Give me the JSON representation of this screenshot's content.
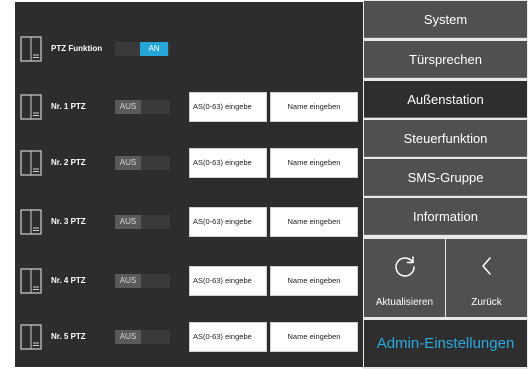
{
  "rows": [
    {
      "label": "PTZ Funktion",
      "toggle": "AN"
    },
    {
      "label": "Nr. 1 PTZ",
      "toggle": "AUS",
      "addr_value": "AS(0-63) eingebe",
      "name_value": "Name eingeben"
    },
    {
      "label": "Nr. 2 PTZ",
      "toggle": "AUS",
      "addr_value": "AS(0-63) eingebe",
      "name_value": "Name eingeben"
    },
    {
      "label": "Nr. 3 PTZ",
      "toggle": "AUS",
      "addr_value": "AS(0-63) eingebe",
      "name_value": "Name eingeben"
    },
    {
      "label": "Nr. 4 PTZ",
      "toggle": "AUS",
      "addr_value": "AS(0-63) eingebe",
      "name_value": "Name eingeben"
    },
    {
      "label": "Nr. 5 PTZ",
      "toggle": "AUS",
      "addr_value": "AS(0-63) eingebe",
      "name_value": "Name eingeben"
    }
  ],
  "menu": {
    "items": [
      "System",
      "Türsprechen",
      "Außenstation",
      "Steuerfunktion",
      "SMS-Gruppe",
      "Information"
    ],
    "active": "Außenstation"
  },
  "actions": {
    "refresh_label": "Aktualisieren",
    "back_label": "Zurück"
  },
  "footer": {
    "title": "Admin-Einstellungen"
  },
  "icons": {
    "row_icon": "device-panel-icon",
    "refresh_icon": "refresh-icon",
    "back_icon": "chevron-left-icon"
  },
  "colors": {
    "accent": "#29a9e0",
    "toggle_on": "#25a6d9",
    "panel_dark": "#2d2d2d",
    "menu_button": "#505050"
  }
}
